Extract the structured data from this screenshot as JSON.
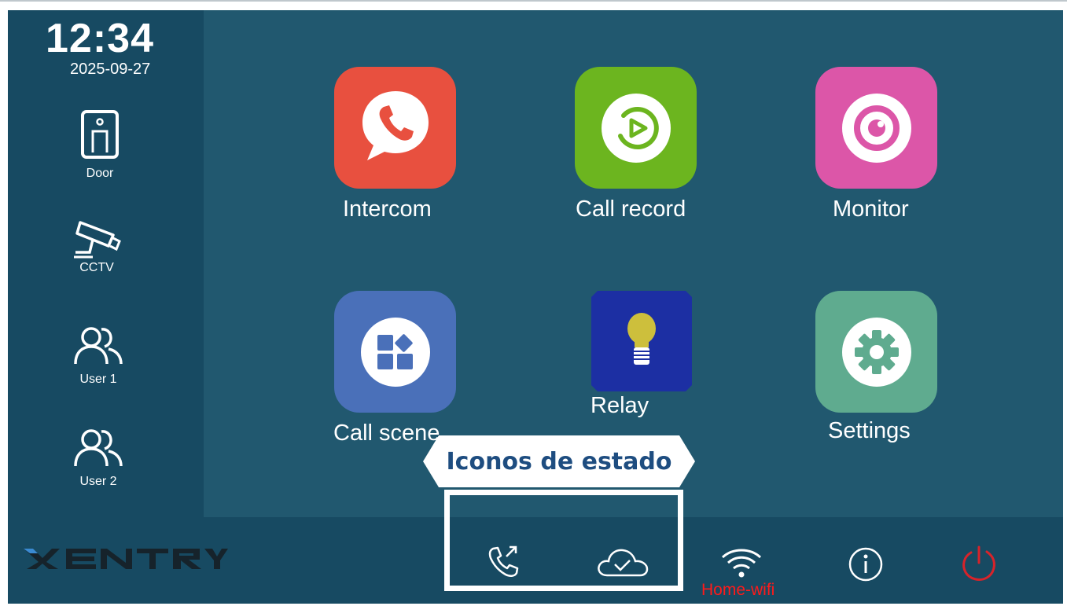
{
  "clock": {
    "time": "12:34",
    "date": "2025-09-27"
  },
  "sidebar": {
    "items": [
      {
        "label": "Door",
        "icon": "door-icon"
      },
      {
        "label": "CCTV",
        "icon": "cctv-camera-icon"
      },
      {
        "label": "User 1",
        "icon": "users-icon"
      },
      {
        "label": "User 2",
        "icon": "users-icon"
      }
    ]
  },
  "apps": [
    {
      "label": "Intercom",
      "icon": "phone-bubble-icon",
      "color": "#e8503f"
    },
    {
      "label": "Call record",
      "icon": "play-record-icon",
      "color": "#6cb51f"
    },
    {
      "label": "Monitor",
      "icon": "eye-lens-icon",
      "color": "#dc56a8"
    },
    {
      "label": "Call scene",
      "icon": "grid-scene-icon",
      "color": "#4a70b9"
    },
    {
      "label": "Relay",
      "icon": "light-bulb-icon",
      "color": "#1c2fa3"
    },
    {
      "label": "Settings",
      "icon": "gear-icon",
      "color": "#5fab8f"
    }
  ],
  "annotation": {
    "callout": "Iconos de estado"
  },
  "bottombar": {
    "logo": "XENTRY",
    "status_icons": [
      "call-forward-icon",
      "cloud-check-icon"
    ],
    "wifi": {
      "icon": "wifi-icon",
      "name": "Home-wifi",
      "name_color": "#ff1a1a"
    },
    "info_icon": "info-icon",
    "power_icon": "power-icon",
    "power_color": "#d8232a"
  }
}
